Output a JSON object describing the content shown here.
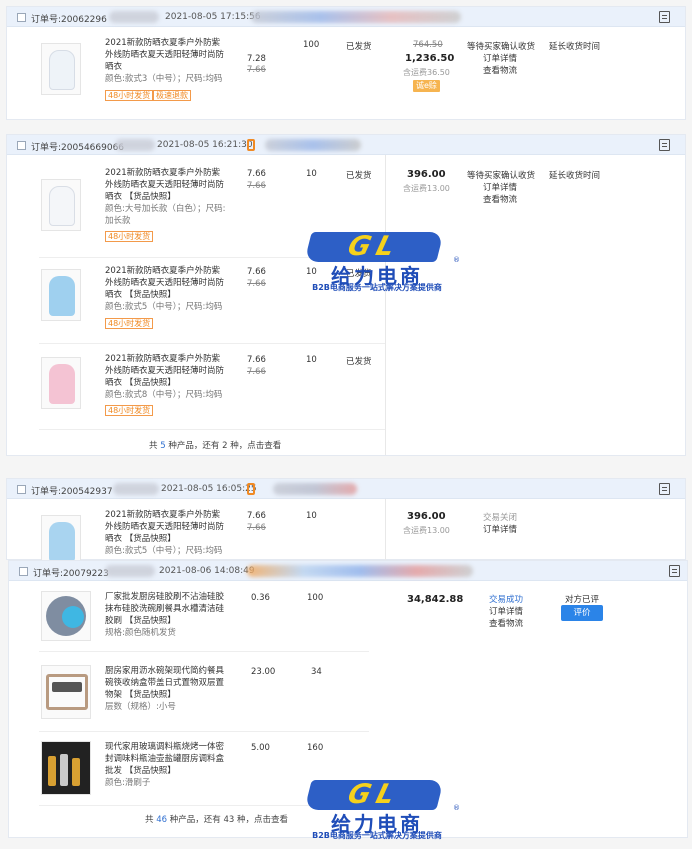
{
  "labels": {
    "order_no": "订单号:",
    "seller_buttons": "评价"
  },
  "orders": [
    {
      "no": "20062296",
      "date": "2021-08-05 17:15:56",
      "items": [
        {
          "title": "2021新款防晒衣夏季户外防紫外线防晒衣夏天透阳轻薄时尚防晒衣",
          "attr": "颜色:款式3（中号）；尺码:均码",
          "tags": [
            "48小时发货",
            "极速退款"
          ],
          "price": "7.28",
          "orig": "7.66",
          "qty": "100",
          "ship": "已发货"
        }
      ],
      "total_orig": "764.50",
      "total": "1,236.50",
      "freight": "含运费36.50",
      "badge": "诚e赊",
      "status": "等待买家确认收货",
      "links": [
        "订单详情",
        "查看物流"
      ],
      "action": "延长收货时间"
    },
    {
      "no": "20054669066",
      "date": "2021-08-05 16:21:30",
      "items": [
        {
          "title": "2021新款防晒衣夏季户外防紫外线防晒衣夏天透阳轻薄时尚防晒衣 【货品快照】",
          "attr": "颜色:大号加长款（白色）；尺码:加长款",
          "tags": [
            "48小时发货"
          ],
          "price": "7.66",
          "orig": "7.66",
          "qty": "10",
          "ship": "已发货"
        },
        {
          "title": "2021新款防晒衣夏季户外防紫外线防晒衣夏天透阳轻薄时尚防晒衣 【货品快照】",
          "attr": "颜色:款式5（中号）；尺码:均码",
          "tags": [
            "48小时发货"
          ],
          "price": "7.66",
          "orig": "7.66",
          "qty": "10",
          "ship": "已发货"
        },
        {
          "title": "2021新款防晒衣夏季户外防紫外线防晒衣夏天透阳轻薄时尚防晒衣 【货品快照】",
          "attr": "颜色:款式8（中号）；尺码:均码",
          "tags": [
            "48小时发货"
          ],
          "price": "7.66",
          "orig": "7.66",
          "qty": "10",
          "ship": "已发货"
        }
      ],
      "total": "396.00",
      "freight": "含运费13.00",
      "status": "等待买家确认收货",
      "links": [
        "订单详情",
        "查看物流"
      ],
      "action": "延长收货时间",
      "more": {
        "pre": "共",
        "count": "5",
        "mid": "种产品，还有",
        "rest": "2",
        "post": "种，点击查看"
      }
    },
    {
      "no": "200542937",
      "date": "2021-08-05 16:05:25",
      "items": [
        {
          "title": "2021新款防晒衣夏季户外防紫外线防晒衣夏天透阳轻薄时尚防晒衣 【货品快照】",
          "attr": "颜色:款式5（中号）；尺码:均码",
          "price": "7.66",
          "orig": "7.66",
          "qty": "10"
        }
      ],
      "total": "396.00",
      "freight": "含运费13.00",
      "status": "交易关闭",
      "links": [
        "订单详情"
      ]
    },
    {
      "no": "20079223",
      "date": "2021-08-06 14:08:49",
      "items": [
        {
          "title": "厂家批发厨房硅胶刷不沾油硅胶抹布硅胶洗碗刷餐具水槽清洁硅胶刷 【货品快照】",
          "attr": "规格:颜色随机发货",
          "price": "0.36",
          "qty": "100"
        },
        {
          "title": "厨房家用沥水碗架现代简约餐具碗筷收纳盒带盖日式置物双层置物架 【货品快照】",
          "attr": "层数（规格）:小号",
          "price": "23.00",
          "qty": "34"
        },
        {
          "title": "现代家用玻璃调料瓶烧烤一体密封调味料瓶油壶盐罐厨房调料盒批发 【货品快照】",
          "attr": "颜色:滑刷子",
          "price": "5.00",
          "qty": "160"
        }
      ],
      "total": "34,842.88",
      "status": "交易成功",
      "links": [
        "订单详情",
        "查看物流"
      ],
      "action": "对方已评",
      "button": "评价",
      "more": {
        "pre": "共",
        "count": "46",
        "mid": "种产品，还有",
        "rest": "43",
        "post": "种，点击查看"
      }
    }
  ],
  "watermark": {
    "logo": "GL",
    "name": "给力电商",
    "slogan": "B2B电商服务一站式解决方案提供商",
    "reg": "®"
  },
  "colors": {
    "accent": "#2f6fd0",
    "header_bg": "#eaf1fb",
    "tag": "#f08a24",
    "button": "#2b84e8"
  }
}
